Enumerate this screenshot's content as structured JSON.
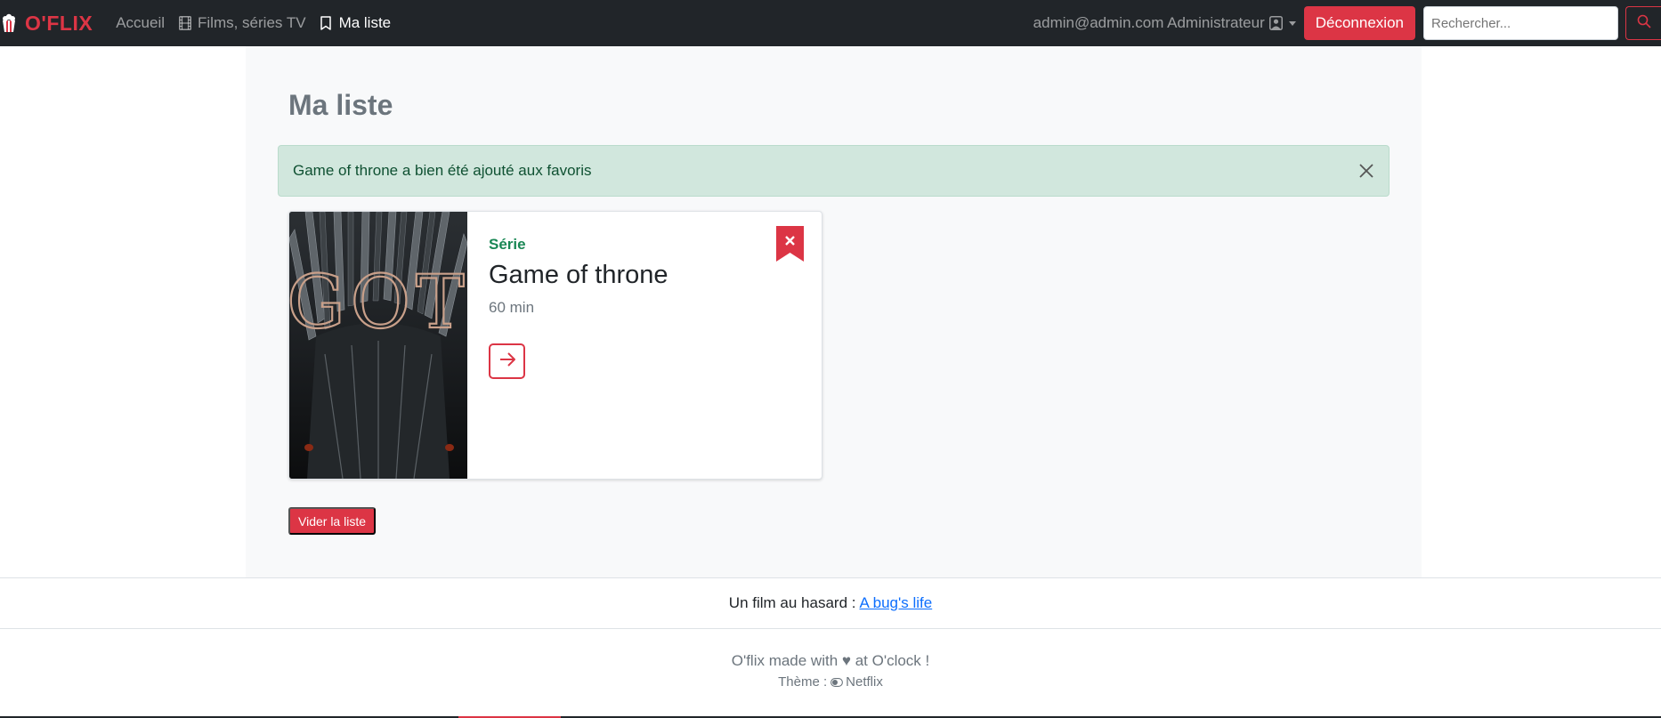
{
  "navbar": {
    "brand": "O'FLIX",
    "brand_icon": "popcorn-icon",
    "links": [
      {
        "label": "Accueil",
        "icon": ""
      },
      {
        "label": "Films, séries TV",
        "icon": "film-icon"
      },
      {
        "label": "Ma liste",
        "icon": "bookmark-icon"
      }
    ],
    "user_label": "admin@admin.com Administrateur",
    "user_icon": "person-square-icon",
    "logout_label": "Déconnexion",
    "search_placeholder": "Rechercher..."
  },
  "page": {
    "title": "Ma liste",
    "alert": "Game of throne a bien été ajouté aux favoris"
  },
  "favorites": [
    {
      "type": "Série",
      "title": "Game of throne",
      "duration": "60 min",
      "poster_text": "GOT"
    }
  ],
  "clear_button": "Vider la liste",
  "footer": {
    "random_prefix": "Un film au hasard :",
    "random_link": "A bug's life",
    "made_with": "O'flix made with ♥ at O'clock !",
    "theme_prefix": "Thème :",
    "theme_name": "Netflix"
  },
  "colors": {
    "accent": "#dc3545",
    "navbar": "#212529",
    "success_text": "#198754",
    "alert_bg": "#d1e7dd"
  }
}
